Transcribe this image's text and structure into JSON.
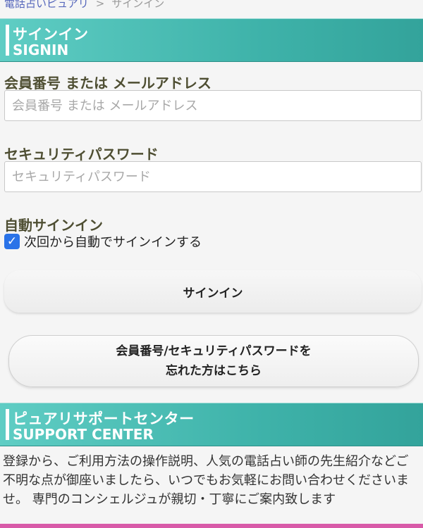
{
  "breadcrumb": {
    "home": "電話占いピュアリ",
    "separator": ">",
    "current": "サインイン"
  },
  "signin_section": {
    "title_jp": "サインイン",
    "title_en": "SIGNIN"
  },
  "member_id": {
    "label": "会員番号 または メールアドレス",
    "placeholder": "会員番号 または メールアドレス",
    "value": ""
  },
  "password": {
    "label": "セキュリティパスワード",
    "placeholder": "セキュリティパスワード",
    "value": ""
  },
  "auto_signin": {
    "label": "自動サインイン",
    "checkbox_label": "次回から自動でサインインする",
    "checked": true
  },
  "signin_button": {
    "label": "サインイン"
  },
  "forgot_button": {
    "line1": "会員番号/セキュリティパスワードを",
    "line2": "忘れた方はこちら"
  },
  "support_section": {
    "title_jp": "ピュアリサポートセンター",
    "title_en": "SUPPORT CENTER",
    "description": "登録から、ご利用方法の操作説明、人気の電話占い師の先生紹介などご不明な点が御座いましたら、いつでもお気軽にお問い合わせくださいませ。 専門のコンシェルジュが親切・丁寧にご案内致します"
  },
  "colors": {
    "header_teal": "#3fb3aa",
    "label_olive": "#4e4e32",
    "checkbox_blue": "#2a73e8",
    "bottom_accent": "#d85aa8"
  }
}
